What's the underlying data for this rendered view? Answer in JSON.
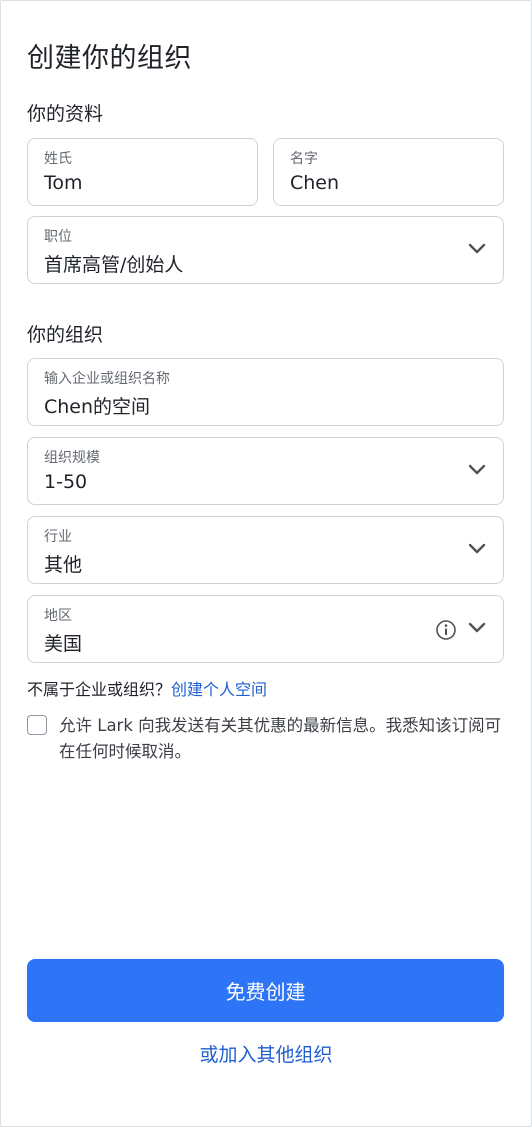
{
  "page": {
    "title": "创建你的组织"
  },
  "profile": {
    "section_title": "你的资料",
    "last_name": {
      "label": "姓氏",
      "value": "Tom"
    },
    "first_name": {
      "label": "名字",
      "value": "Chen"
    },
    "job_title": {
      "label": "职位",
      "value": "首席高管/创始人",
      "icon": "chevron-down-icon"
    }
  },
  "organization": {
    "section_title": "你的组织",
    "name": {
      "label": "输入企业或组织名称",
      "value": "Chen的空间"
    },
    "size": {
      "label": "组织规模",
      "value": "1-50",
      "icon": "chevron-down-icon"
    },
    "industry": {
      "label": "行业",
      "value": "其他",
      "icon": "chevron-down-icon"
    },
    "region": {
      "label": "地区",
      "value": "美国",
      "icons": [
        "info-icon",
        "chevron-down-icon"
      ]
    }
  },
  "no_org": {
    "text": "不属于企业或组织？",
    "link": "创建个人空间"
  },
  "consent": {
    "checked": false,
    "text": "允许 Lark 向我发送有关其优惠的最新信息。我悉知该订阅可在任何时候取消。"
  },
  "actions": {
    "primary": "免费创建",
    "secondary": "或加入其他组织"
  },
  "colors": {
    "primary": "#2e74f6",
    "link": "#1f5fd1",
    "border": "#d0d3d6"
  }
}
